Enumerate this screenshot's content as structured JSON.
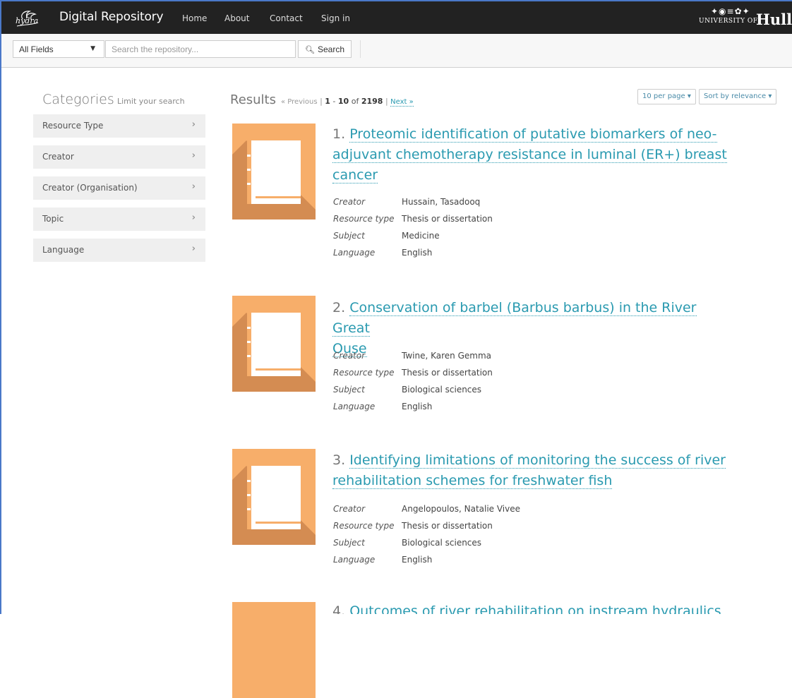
{
  "navbar": {
    "logo_text": "hydra",
    "brand": "Digital Repository",
    "links": [
      "Home",
      "About",
      "Contact",
      "Sign in"
    ],
    "university_small": "UNIVERSITY OF",
    "university_big": "Hull"
  },
  "search": {
    "field_selected": "All Fields",
    "placeholder": "Search the repository...",
    "button_label": "Search"
  },
  "sidebar": {
    "title": "Categories",
    "subtitle": "Limit your search",
    "facets": [
      "Resource Type",
      "Creator",
      "Creator (Organisation)",
      "Topic",
      "Language"
    ]
  },
  "results_header": {
    "title": "Results",
    "previous": "« Previous",
    "separator": "|",
    "range_start": "1",
    "range_dash": " - ",
    "range_end": "10",
    "of": " of ",
    "total": "2198",
    "next": "Next »",
    "per_page": "10 per page",
    "sort": "Sort by relevance"
  },
  "meta_labels": {
    "creator": "Creator",
    "resource_type": "Resource type",
    "subject": "Subject",
    "language": "Language"
  },
  "results": [
    {
      "number": "1.",
      "title_lines": [
        "Proteomic identification of putative biomarkers of neo-",
        "adjuvant chemotherapy resistance in luminal (ER+) breast",
        "cancer"
      ],
      "creator": "Hussain, Tasadooq",
      "resource_type": "Thesis or dissertation",
      "subject": "Medicine",
      "language": "English"
    },
    {
      "number": "2.",
      "title_lines": [
        "Conservation of barbel (Barbus barbus) in the River Great",
        "Ouse"
      ],
      "creator": "Twine, Karen Gemma",
      "resource_type": "Thesis or dissertation",
      "subject": "Biological sciences",
      "language": "English"
    },
    {
      "number": "3.",
      "title_lines": [
        "Identifying limitations of monitoring the success of river",
        "rehabilitation schemes for freshwater fish"
      ],
      "creator": "Angelopoulos, Natalie Vivee",
      "resource_type": "Thesis or dissertation",
      "subject": "Biological sciences",
      "language": "English"
    },
    {
      "number": "4.",
      "title_lines": [
        "Outcomes of river rehabilitation on instream hydraulics and"
      ]
    }
  ]
}
